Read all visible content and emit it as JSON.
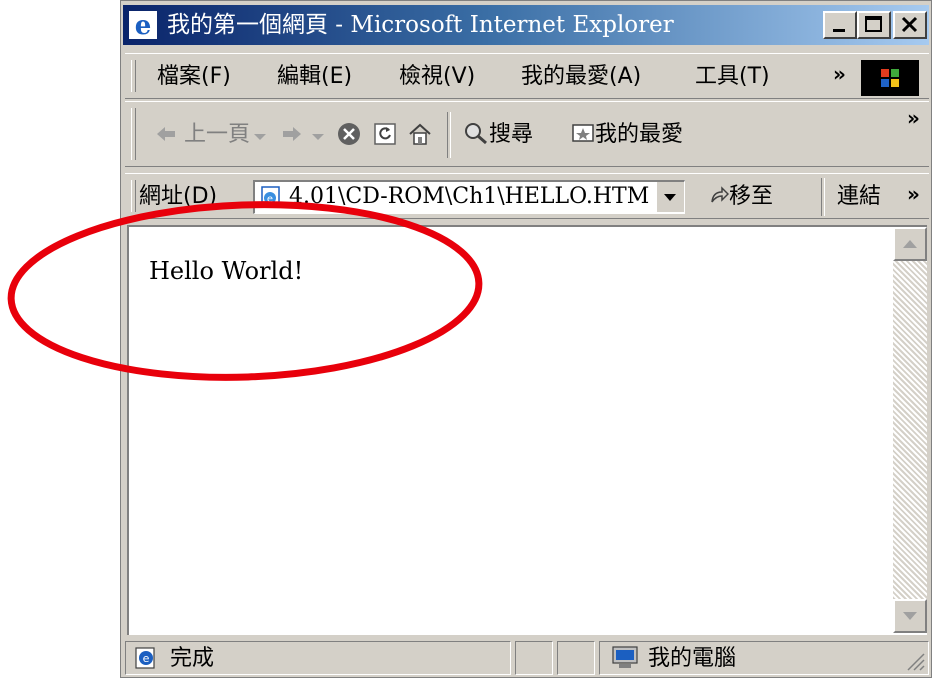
{
  "window": {
    "title_page": "我的第一個網頁",
    "title_app": " - Microsoft Internet Explorer",
    "controls": {
      "minimize": "_",
      "maximize": "□",
      "close": "×"
    }
  },
  "menu": {
    "items": [
      "檔案(F)",
      "編輯(E)",
      "檢視(V)",
      "我的最愛(A)",
      "工具(T)"
    ],
    "more": "»"
  },
  "toolbar": {
    "back_label": "上一頁",
    "search_label": "搜尋",
    "favorites_label": "我的最愛",
    "more": "»"
  },
  "address": {
    "label": "網址(D)",
    "value": "4.01\\CD-ROM\\Ch1\\HELLO.HTM",
    "go_label": "移至",
    "links_label": "連結",
    "more": "»"
  },
  "page": {
    "text": "Hello World!"
  },
  "status": {
    "text": "完成",
    "zone": "我的電腦"
  },
  "colors": {
    "title_start": "#0a246a",
    "title_end": "#a6caf0",
    "chrome": "#d4d0c8",
    "annotation": "#e8000b"
  }
}
